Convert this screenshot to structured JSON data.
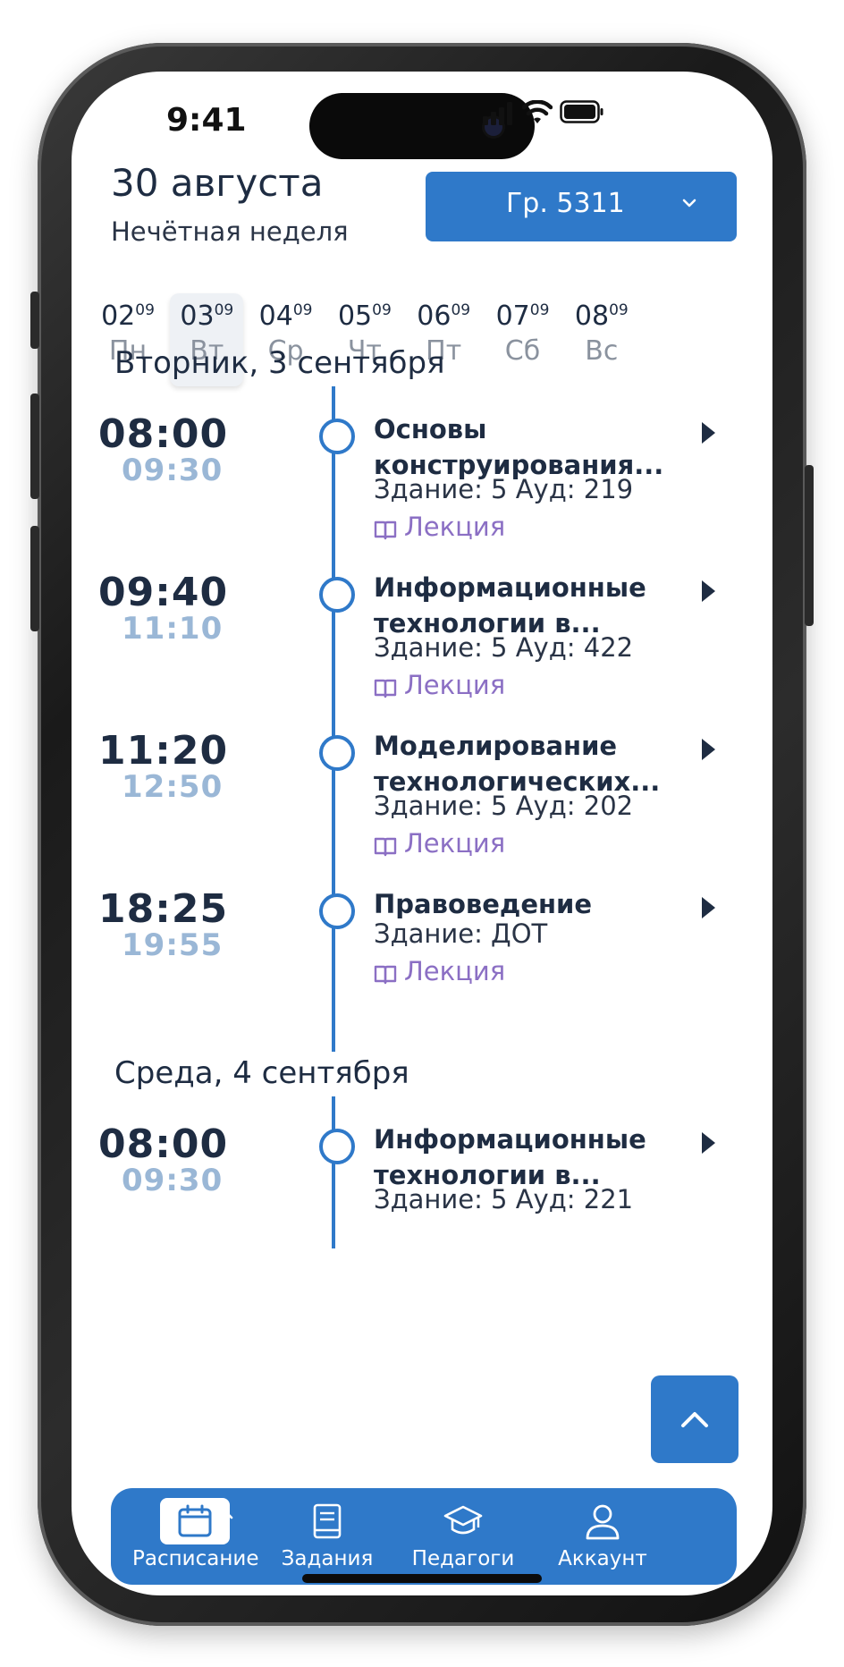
{
  "status": {
    "time": "9:41"
  },
  "header": {
    "date": "30 августа",
    "week_type": "Нечётная неделя",
    "group_label": "Гр. 5311"
  },
  "week": [
    {
      "num": "02",
      "month": "09",
      "name": "Пн",
      "selected": false
    },
    {
      "num": "03",
      "month": "09",
      "name": "Вт",
      "selected": true
    },
    {
      "num": "04",
      "month": "09",
      "name": "Ср",
      "selected": false
    },
    {
      "num": "05",
      "month": "09",
      "name": "Чт",
      "selected": false
    },
    {
      "num": "06",
      "month": "09",
      "name": "Пт",
      "selected": false
    },
    {
      "num": "07",
      "month": "09",
      "name": "Сб",
      "selected": false
    },
    {
      "num": "08",
      "month": "09",
      "name": "Вс",
      "selected": false
    }
  ],
  "days": [
    {
      "heading": "Вторник, 3 сентября",
      "lessons": [
        {
          "start": "08:00",
          "end": "09:30",
          "subject_line1": "Основы",
          "subject_line2": "конструирования...",
          "room": "Здание: 5 Ауд: 219",
          "type": "Лекция"
        },
        {
          "start": "09:40",
          "end": "11:10",
          "subject_line1": "Информационные",
          "subject_line2": "технологии в...",
          "room": "Здание: 5 Ауд: 422",
          "type": "Лекция"
        },
        {
          "start": "11:20",
          "end": "12:50",
          "subject_line1": "Моделирование",
          "subject_line2": "технологических...",
          "room": "Здание: 5 Ауд: 202",
          "type": "Лекция"
        },
        {
          "start": "18:25",
          "end": "19:55",
          "subject_line1": "Правоведение",
          "subject_line2": "",
          "room": "Здание: ДОТ",
          "type": "Лекция"
        }
      ]
    },
    {
      "heading": "Среда, 4 сентября",
      "lessons": [
        {
          "start": "08:00",
          "end": "09:30",
          "subject_line1": "Информационные",
          "subject_line2": "технологии в...",
          "room": "Здание: 5 Ауд: 221",
          "type": ""
        }
      ]
    }
  ],
  "nav": [
    {
      "label": "Расписание",
      "icon": "calendar-icon",
      "active": true
    },
    {
      "label": "Задания",
      "icon": "book-icon",
      "active": false
    },
    {
      "label": "Педагоги",
      "icon": "graduation-cap-icon",
      "active": false
    },
    {
      "label": "Аккаунт",
      "icon": "user-icon",
      "active": false
    }
  ],
  "colors": {
    "accent": "#2f79c9",
    "text_dark": "#1e2c42",
    "time_end": "#9ab7d6",
    "lesson_type": "#8b6fc4"
  }
}
